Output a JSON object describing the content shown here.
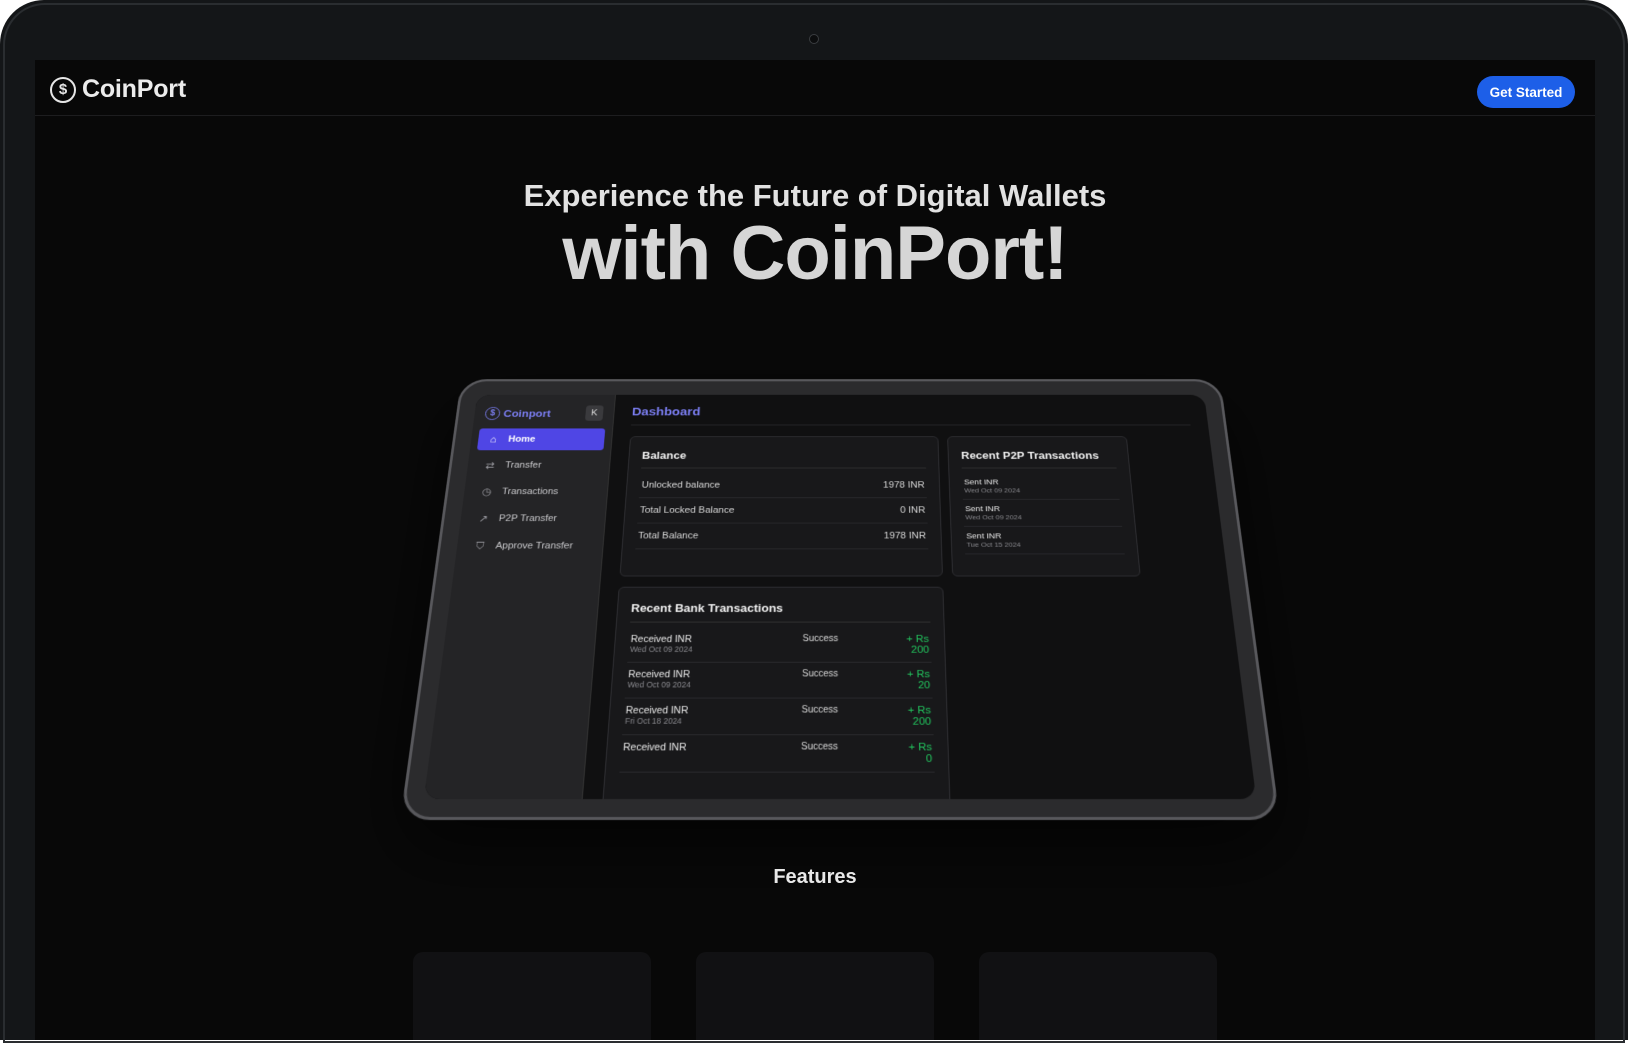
{
  "nav": {
    "brand": "CoinPort",
    "cta": "Get Started"
  },
  "hero": {
    "subtitle": "Experience the Future of Digital Wallets",
    "title": "with CoinPort!"
  },
  "tablet": {
    "sidebar": {
      "brand": "Coinport",
      "collapse_glyph": "K",
      "items": [
        {
          "label": "Home",
          "icon": "home-icon"
        },
        {
          "label": "Transfer",
          "icon": "transfer-icon"
        },
        {
          "label": "Transactions",
          "icon": "clock-icon"
        },
        {
          "label": "P2P Transfer",
          "icon": "arrow-up-right-icon"
        },
        {
          "label": "Approve Transfer",
          "icon": "shield-check-icon"
        }
      ]
    },
    "dashboard_title": "Dashboard",
    "balance": {
      "title": "Balance",
      "rows": [
        {
          "label": "Unlocked balance",
          "value": "1978 INR"
        },
        {
          "label": "Total Locked Balance",
          "value": "0 INR"
        },
        {
          "label": "Total Balance",
          "value": "1978 INR"
        }
      ]
    },
    "p2p": {
      "title": "Recent P2P Transactions",
      "rows": [
        {
          "label": "Sent INR",
          "date": "Wed Oct 09 2024"
        },
        {
          "label": "Sent INR",
          "date": "Wed Oct 09 2024"
        },
        {
          "label": "Sent INR",
          "date": "Tue Oct 15 2024"
        }
      ]
    },
    "bank": {
      "title": "Recent Bank Transactions",
      "rows": [
        {
          "label": "Received INR",
          "date": "Wed Oct 09 2024",
          "status": "Success",
          "amount": "+ Rs 200"
        },
        {
          "label": "Received INR",
          "date": "Wed Oct 09 2024",
          "status": "Success",
          "amount": "+ Rs 20"
        },
        {
          "label": "Received INR",
          "date": "Fri Oct 18 2024",
          "status": "Success",
          "amount": "+ Rs 200"
        },
        {
          "label": "Received INR",
          "date": "",
          "status": "Success",
          "amount": "+ Rs 0"
        }
      ]
    }
  },
  "features": {
    "title": "Features"
  },
  "colors": {
    "accent": "#1d5fe8",
    "sidebar_active": "#4f46e5",
    "dashboard_title": "#7b7ef2",
    "amount_positive": "#22c55e"
  }
}
